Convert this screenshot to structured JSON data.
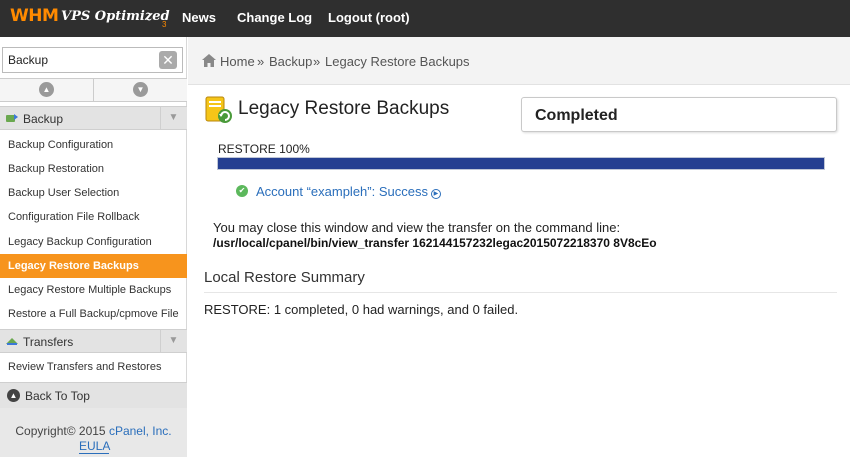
{
  "topbar": {
    "logo_main": "WHM",
    "logo_sub": "VPS Optimized",
    "logo_version": "3",
    "nav": [
      "News",
      "Change Log",
      "Logout (root)"
    ]
  },
  "sidebar": {
    "search_value": "Backup",
    "clear_glyph": "✕",
    "scroll_up_glyph": "▲",
    "scroll_down_glyph": "▼",
    "categories": [
      {
        "label": "Backup",
        "icon": "backup-icon"
      },
      {
        "label": "Transfers",
        "icon": "transfers-icon"
      }
    ],
    "backup_items": [
      "Backup Configuration",
      "Backup Restoration",
      "Backup User Selection",
      "Configuration File Rollback",
      "Legacy Backup Configuration",
      "Legacy Restore Backups",
      "Legacy Restore Multiple Backups",
      "Restore a Full Backup/cpmove File"
    ],
    "transfer_items": [
      "Review Transfers and Restores"
    ],
    "active_item": "Legacy Restore Backups",
    "back_to_top": "Back To Top",
    "footer": {
      "copyright": "Copyright© 2015",
      "company": "cPanel, Inc.",
      "eula": "EULA"
    }
  },
  "breadcrumb": {
    "home": "Home",
    "separator": "»",
    "section": "Backup",
    "current": "Legacy Restore Backups"
  },
  "main": {
    "title": "Legacy Restore Backups",
    "status": "Completed",
    "progress_label": "RESTORE 100%",
    "progress_percent": 100,
    "account_result": "Account “exampleh”: Success",
    "close_message": "You may close this window and view the transfer on the command line:",
    "command": "/usr/local/cpanel/bin/view_transfer 162144157232legac2015072218370 8V8cEo",
    "summary_heading": "Local Restore Summary",
    "summary_text": "RESTORE: 1 completed, 0 had warnings, and 0 failed."
  },
  "colors": {
    "topbar": "#2f2f2f",
    "brand_orange": "#ff8a00",
    "active_item": "#f7941d",
    "progress_fill": "#253f91",
    "link": "#2a6ebb",
    "success": "#5cb85c"
  }
}
